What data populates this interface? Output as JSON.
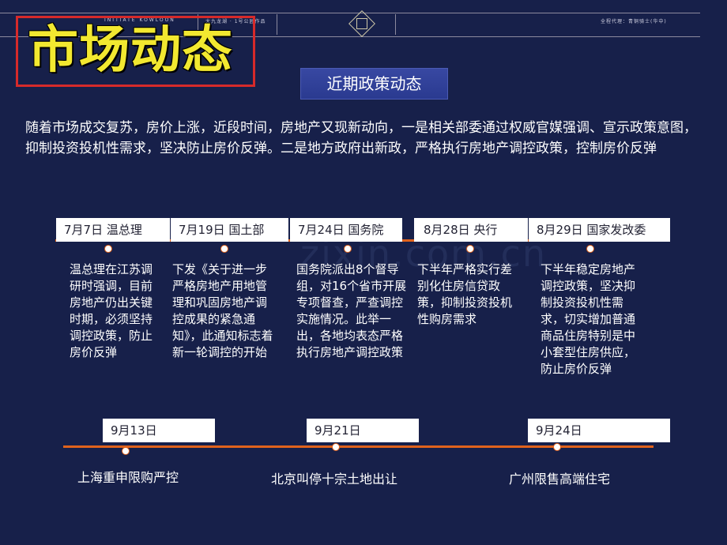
{
  "header": {
    "left_brand": "INITIATE  KOWLOON",
    "center_caption": "大九龙湖 · 1号公园作品",
    "right_caption": "全程代理：青铜骑士(华中)"
  },
  "title": "市场动态",
  "subtitle": "近期政策动态",
  "intro": "随着市场成交复苏，房价上涨，近段时间，房地产又现新动向，一是相关部委通过权威官媒强调、宣示政策意图，抑制投资投机性需求，坚决防止房价反弹。二是地方政府出新政，严格执行房地产调控政策，控制房价反弹",
  "watermark": "zixin.com.cn",
  "top_timeline": [
    {
      "date": "7月7日  温总理",
      "text": "温总理在江苏调研时强调，目前房地产仍出关键时期，必须坚持调控政策，防止房价反弹"
    },
    {
      "date": "7月19日  国土部",
      "text": "下发《关于进一步严格房地产用地管理和巩固房地产调控成果的紧急通知》，此通知标志着新一轮调控的开始"
    },
    {
      "date": "7月24日  国务院",
      "text": "国务院派出8个督导组，对16个省市开展专项督查，严查调控实施情况。此举一出，各地均表态严格执行房地产调控政策"
    },
    {
      "date": "8月28日  央行",
      "text": "下半年严格实行差别化住房信贷政策，抑制投资投机性购房需求"
    },
    {
      "date": "8月29日  国家发改委",
      "text": "下半年稳定房地产调控政策，坚决抑制投资投机性需求，切实增加普通商品住房特别是中小套型住房供应，防止房价反弹"
    }
  ],
  "bottom_timeline": [
    {
      "date": "9月13日",
      "text": "上海重申限购严控"
    },
    {
      "date": "9月21日",
      "text": "北京叫停十宗土地出让"
    },
    {
      "date": "9月24日",
      "text": "广州限售高端住宅"
    }
  ],
  "colors": {
    "background": "#17204a",
    "title_yellow": "#f2e830",
    "title_border": "#d62a2a",
    "timeline_orange": "#e0621c",
    "subtitle_bg": "#3848a2"
  }
}
